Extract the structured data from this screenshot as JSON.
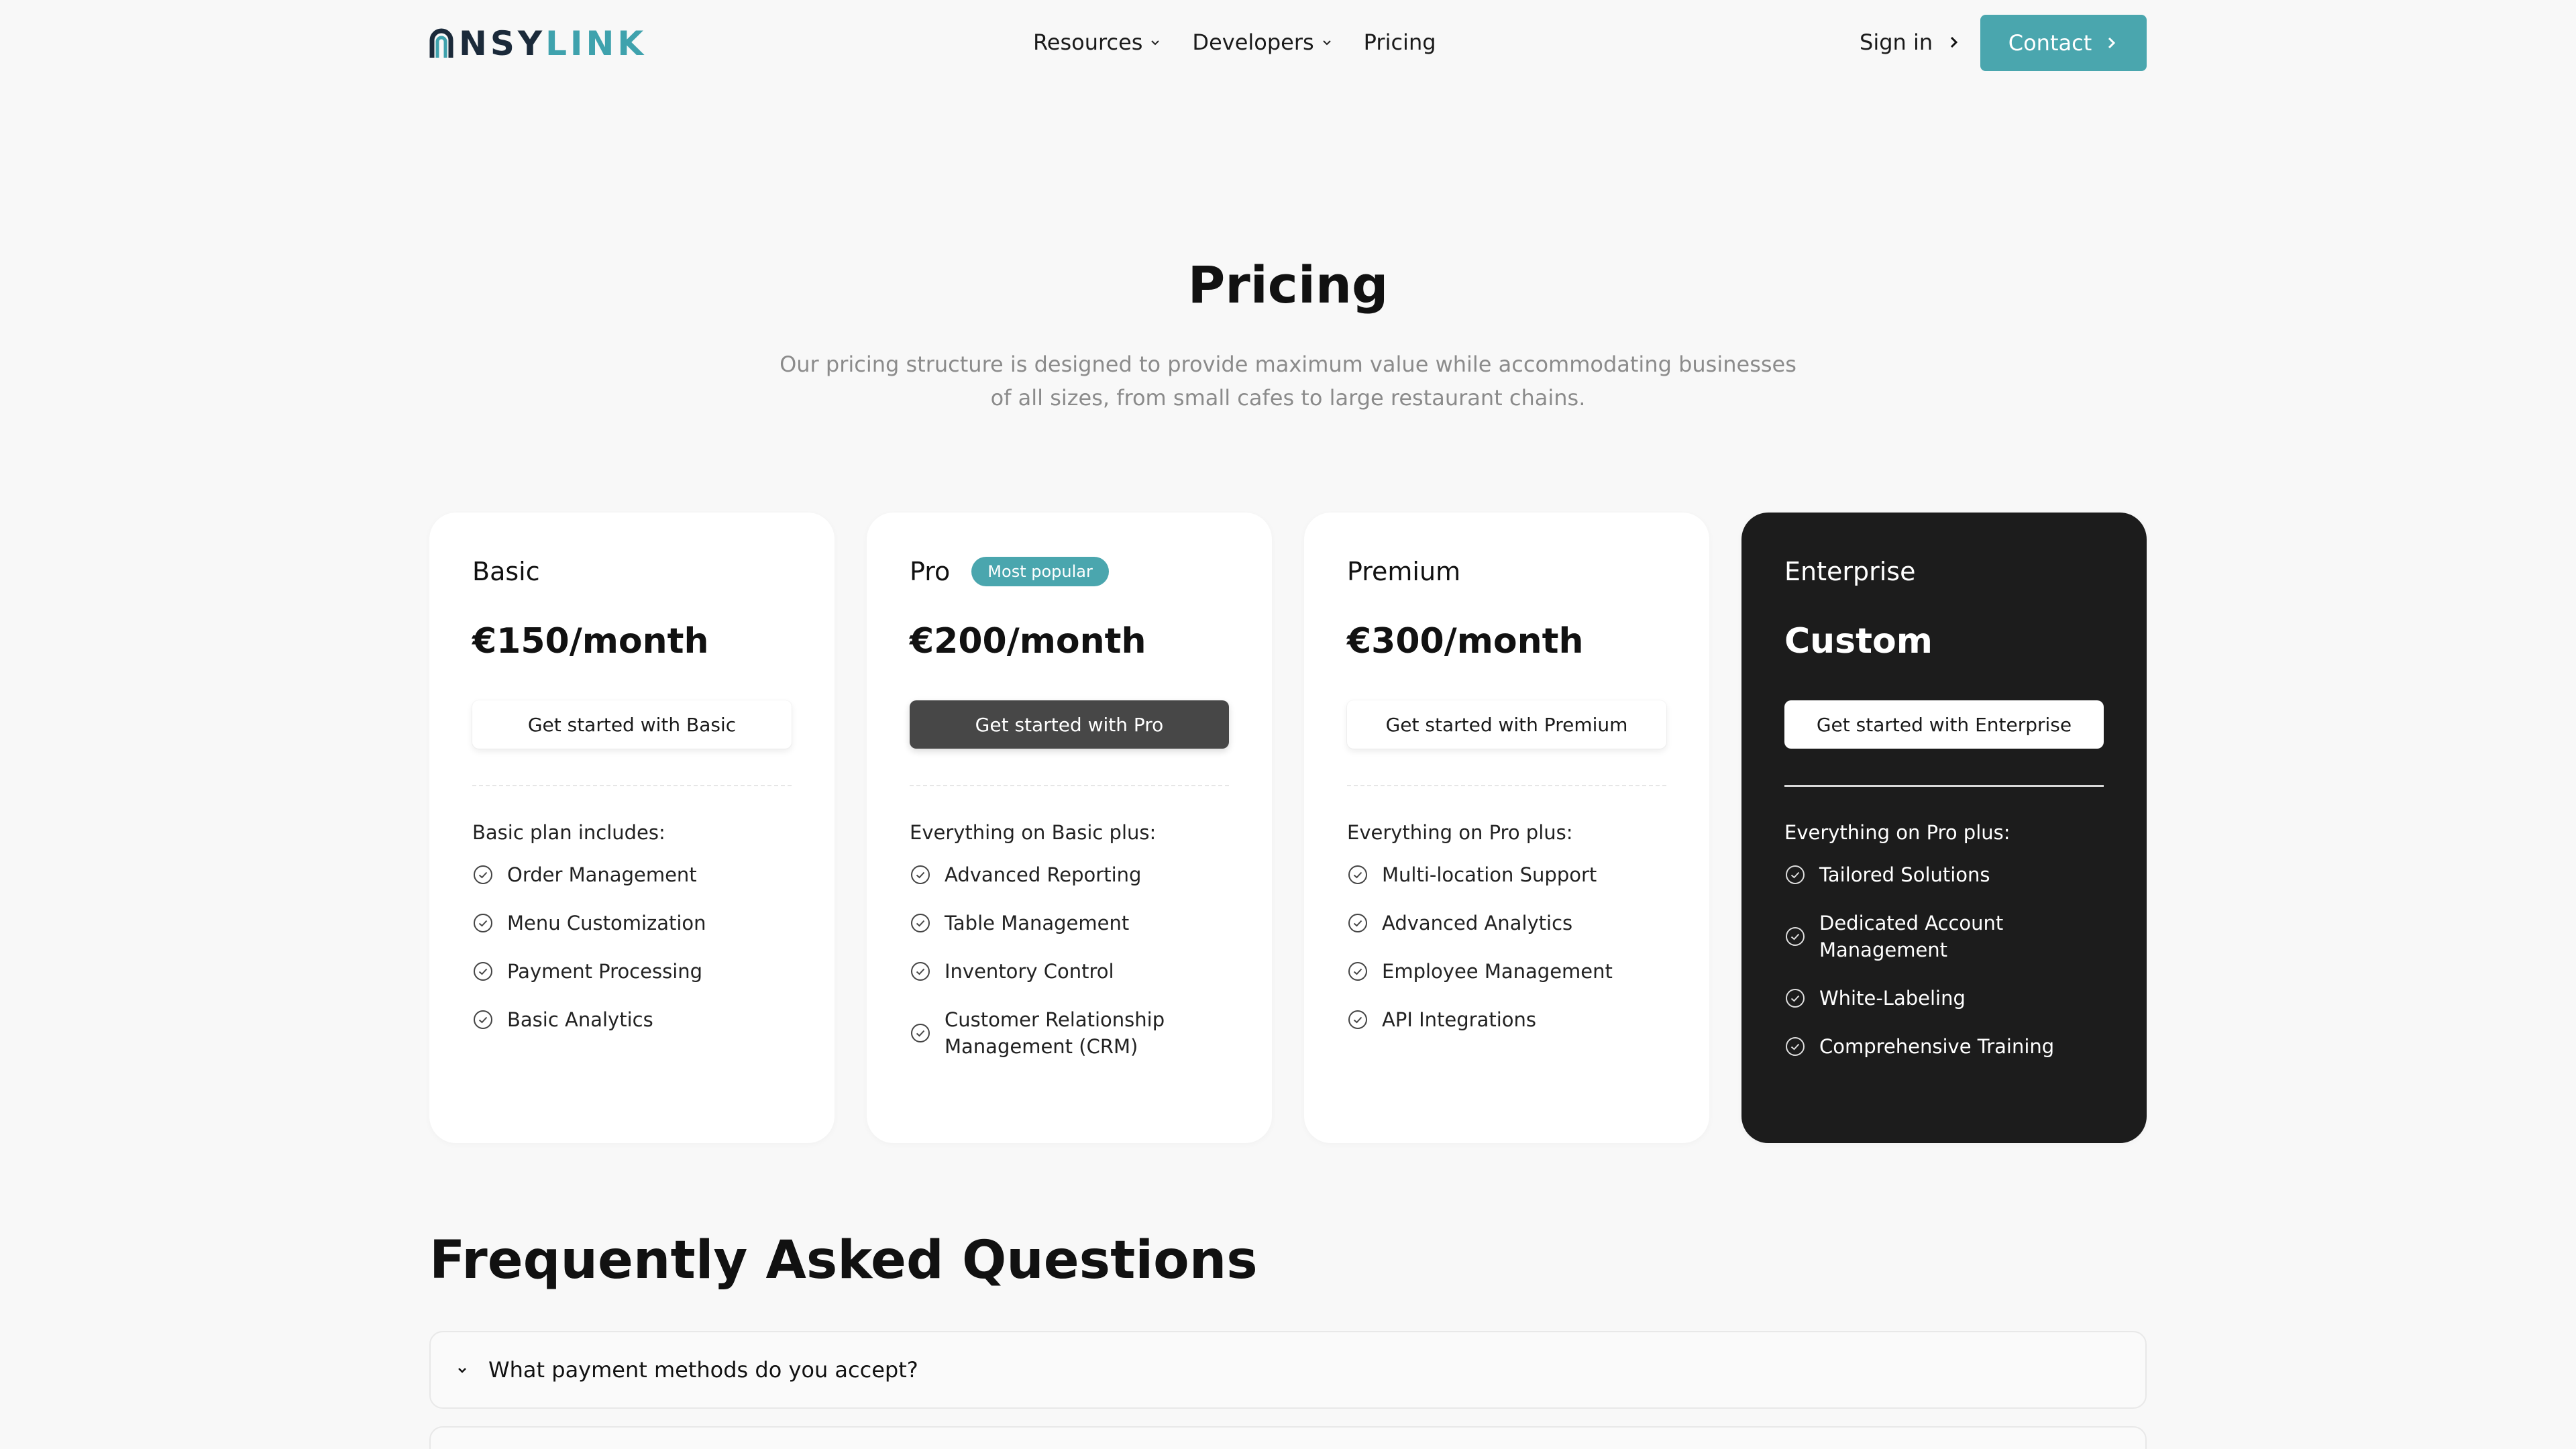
{
  "brand": {
    "logo_dark": "NSY",
    "logo_teal": "LINK",
    "teal_color": "#3fa2ad",
    "dark_color": "#1b2a3a"
  },
  "nav": {
    "items": [
      {
        "label": "Resources",
        "has_dropdown": true
      },
      {
        "label": "Developers",
        "has_dropdown": true
      },
      {
        "label": "Pricing",
        "has_dropdown": false
      }
    ],
    "sign_in": "Sign in",
    "contact": "Contact"
  },
  "hero": {
    "title": "Pricing",
    "subtitle_line1": "Our pricing structure is designed to provide maximum value while accommodating businesses",
    "subtitle_line2": "of all sizes, from small cafes to large restaurant chains."
  },
  "plans": [
    {
      "name": "Basic",
      "price": "€150/month",
      "cta": "Get started with Basic",
      "includes": "Basic plan includes:",
      "features": [
        "Order Management",
        "Menu Customization",
        "Payment Processing",
        "Basic Analytics"
      ]
    },
    {
      "name": "Pro",
      "badge": "Most popular",
      "price": "€200/month",
      "cta": "Get started with Pro",
      "includes": "Everything on Basic plus:",
      "features": [
        "Advanced Reporting",
        "Table Management",
        "Inventory Control",
        "Customer Relationship Management (CRM)"
      ]
    },
    {
      "name": "Premium",
      "price": "€300/month",
      "cta": "Get started with Premium",
      "includes": "Everything on Pro plus:",
      "features": [
        "Multi-location Support",
        "Advanced Analytics",
        "Employee Management",
        "API Integrations"
      ]
    },
    {
      "name": "Enterprise",
      "price": "Custom",
      "cta": "Get started with Enterprise",
      "includes": "Everything on Pro plus:",
      "features": [
        "Tailored Solutions",
        "Dedicated Account Management",
        "White-Labeling",
        "Comprehensive Training"
      ]
    }
  ],
  "faq": {
    "title": "Frequently Asked Questions",
    "items": [
      {
        "question": "What payment methods do you accept?"
      }
    ]
  },
  "colors": {
    "accent": "#4aa6ae",
    "background": "#f8f8f8",
    "dark_card": "#1c1c1c"
  }
}
